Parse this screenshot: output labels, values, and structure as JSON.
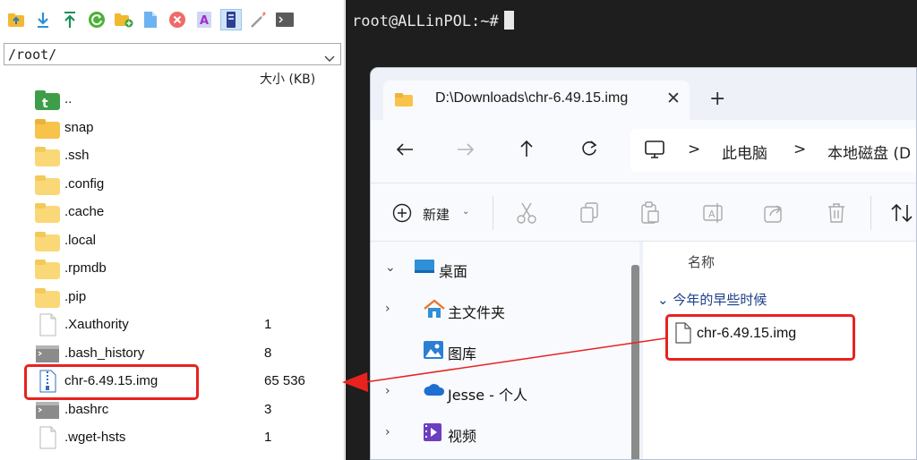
{
  "left_pane": {
    "path": "/root/",
    "size_header": "大小 (KB)",
    "toolbar_icons": [
      "up-folder-icon",
      "download-icon",
      "upload-icon",
      "refresh-icon",
      "new-folder-icon",
      "new-file-icon",
      "delete-icon",
      "rename-icon",
      "properties-icon",
      "edit-icon",
      "terminal-icon"
    ],
    "files": [
      {
        "name": "..",
        "size": "",
        "icon": "parent-folder-icon"
      },
      {
        "name": "snap",
        "size": "",
        "icon": "folder-icon"
      },
      {
        "name": ".ssh",
        "size": "",
        "icon": "folder-icon"
      },
      {
        "name": ".config",
        "size": "",
        "icon": "folder-icon"
      },
      {
        "name": ".cache",
        "size": "",
        "icon": "folder-icon"
      },
      {
        "name": ".local",
        "size": "",
        "icon": "folder-icon"
      },
      {
        "name": ".rpmdb",
        "size": "",
        "icon": "folder-icon"
      },
      {
        "name": ".pip",
        "size": "",
        "icon": "folder-icon"
      },
      {
        "name": ".Xauthority",
        "size": "1",
        "icon": "file-icon"
      },
      {
        "name": ".bash_history",
        "size": "8",
        "icon": "script-file-icon"
      },
      {
        "name": "chr-6.49.15.img",
        "size": "65 536",
        "icon": "zip-file-icon"
      },
      {
        "name": ".bashrc",
        "size": "3",
        "icon": "script-file-icon"
      },
      {
        "name": ".wget-hsts",
        "size": "1",
        "icon": "file-icon"
      }
    ]
  },
  "terminal": {
    "prompt": "root@ALLinPOL:~#"
  },
  "explorer": {
    "tab_title": "D:\\Downloads\\chr-6.49.15.img",
    "tab_close": "✕",
    "tab_new": "+",
    "breadcrumb": [
      "此电脑",
      "本地磁盘 (D"
    ],
    "new_button": "新建",
    "nav_tree": [
      {
        "label": "桌面",
        "icon": "desktop-icon",
        "expanded": true
      },
      {
        "label": "主文件夹",
        "icon": "home-icon",
        "expanded": false
      },
      {
        "label": "图库",
        "icon": "gallery-icon",
        "expanded": null
      },
      {
        "label": "Jesse - 个人",
        "icon": "onedrive-cloud-icon",
        "expanded": false
      },
      {
        "label": "视频",
        "icon": "videos-icon",
        "expanded": false
      }
    ],
    "column_name": "名称",
    "group_header": "今年的早些时候",
    "content_file": "chr-6.49.15.img"
  },
  "colors": {
    "highlight_red": "#e8221f",
    "terminal_bg": "#1e1e1e",
    "folder_yellow": "#f8c34a"
  }
}
